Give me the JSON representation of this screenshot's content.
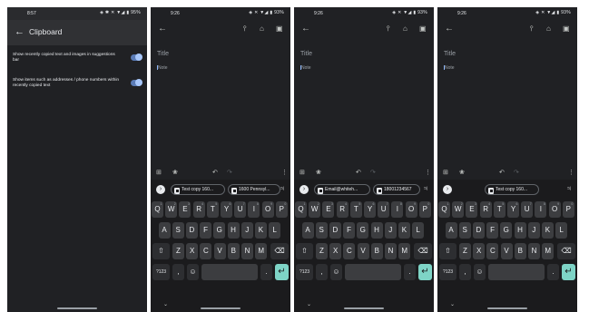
{
  "settings": {
    "status_time": "8:57",
    "status_icons": "◈ ✱ ✕ ▼◢ ▮ 95%",
    "back_glyph": "←",
    "title": "Clipboard",
    "rows": [
      {
        "text": "Show recently copied text and images in suggestions bar",
        "enabled": true
      },
      {
        "text": "Show items such as addresses / phone numbers within recently copied text",
        "enabled": true
      }
    ]
  },
  "note": {
    "status_time": "9:26",
    "status_icons": "◈ ✕ ▼◢ ▮ 93%",
    "back_glyph": "←",
    "pin_glyph": "⫯",
    "bell_glyph": "⌂",
    "archive_glyph": "▣",
    "title_placeholder": "Title",
    "body_placeholder": "Note",
    "add_glyph": "⊞",
    "palette_glyph": "❀",
    "undo_glyph": "↶",
    "redo_glyph": "↷",
    "more_glyph": "⋮"
  },
  "keyboard": {
    "expand_glyph": "›",
    "mic_glyph": "♃",
    "row1": [
      {
        "k": "Q",
        "n": "1"
      },
      {
        "k": "W",
        "n": "2"
      },
      {
        "k": "E",
        "n": "3"
      },
      {
        "k": "R",
        "n": "4"
      },
      {
        "k": "T",
        "n": "5"
      },
      {
        "k": "Y",
        "n": "6"
      },
      {
        "k": "U",
        "n": "7"
      },
      {
        "k": "I",
        "n": "8"
      },
      {
        "k": "O",
        "n": "9"
      },
      {
        "k": "P",
        "n": "0"
      }
    ],
    "row2": [
      "A",
      "S",
      "D",
      "F",
      "G",
      "H",
      "J",
      "K",
      "L"
    ],
    "row3": [
      "Z",
      "X",
      "C",
      "V",
      "B",
      "N",
      "M"
    ],
    "shift_glyph": "⇧",
    "backspace_glyph": "⌫",
    "symbols_label": "?123",
    "comma_label": ",",
    "emoji_glyph": "☺",
    "period_label": ".",
    "enter_glyph": "↵",
    "hide_glyph": "⌄"
  },
  "clips": {
    "screen2": [
      "Test copy 160...",
      "1600 Pennsyl..."
    ],
    "screen3": [
      "Email@whiteh...",
      "18001234567"
    ],
    "screen4": [
      "Test copy 160..."
    ]
  },
  "colors": {
    "background": "#202124",
    "keyboard": "#1b1b1d",
    "key": "#3c3d40",
    "enter_key": "#7ed4c6",
    "toggle": "#a8c7fa"
  }
}
